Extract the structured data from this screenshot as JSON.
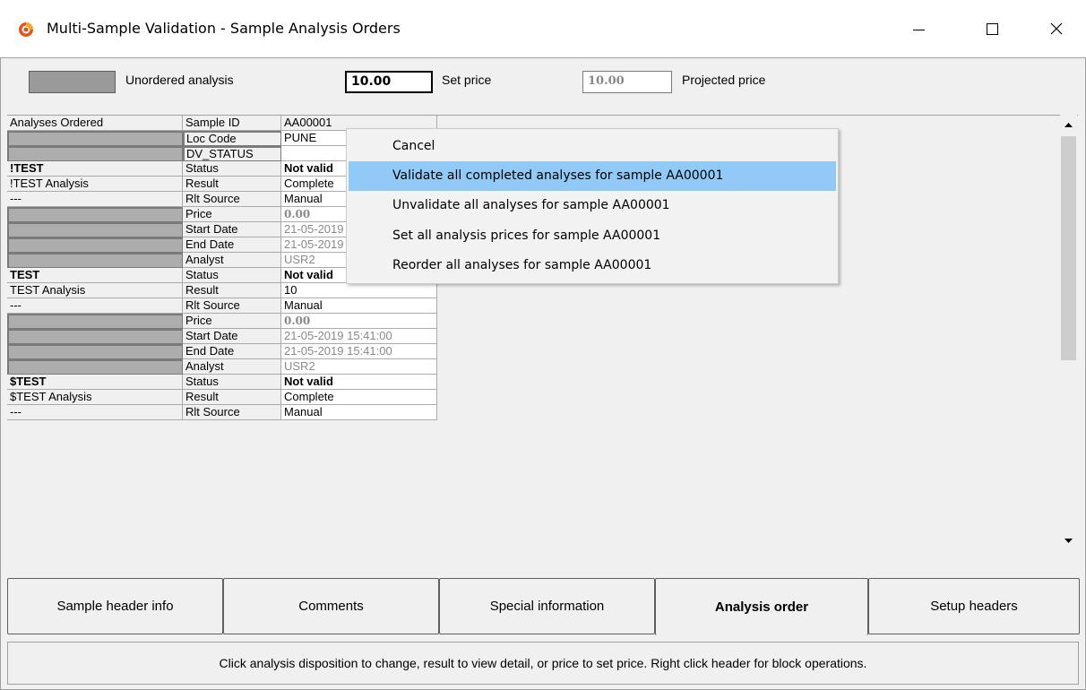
{
  "window": {
    "title": "Multi-Sample Validation - Sample Analysis Orders",
    "icon": "app-logo-icon",
    "buttons": [
      "minimize-icon",
      "maximize-icon",
      "close-icon"
    ]
  },
  "header": {
    "unordered_label": "Unordered analysis",
    "set_price_value": "10.00",
    "set_price_label": "Set price",
    "projected_price_value": "10.00",
    "projected_label": "Projected price",
    "unordered_color": "#9a9a9a"
  },
  "grid": {
    "rows": [
      {
        "a": "Analyses Ordered",
        "b": "Sample ID",
        "c": "AA00001"
      },
      {
        "a": "",
        "b": "Loc Code",
        "c": "PUNE"
      },
      {
        "a": "",
        "b": "DV_STATUS",
        "c": ""
      },
      {
        "a": "!TEST",
        "b": "Status",
        "c": "Not valid"
      },
      {
        "a": "!TEST Analysis",
        "b": "Result",
        "c": "Complete"
      },
      {
        "a": "---",
        "b": "Rlt Source",
        "c": "Manual"
      },
      {
        "a": "",
        "b": "Price",
        "c": "0.00"
      },
      {
        "a": "",
        "b": "Start Date",
        "c": "21-05-2019 15:41:00"
      },
      {
        "a": "",
        "b": "End Date",
        "c": "21-05-2019 15:41:00"
      },
      {
        "a": "",
        "b": "Analyst",
        "c": "USR2"
      },
      {
        "a": "TEST",
        "b": "Status",
        "c": "Not valid"
      },
      {
        "a": "TEST Analysis",
        "b": "Result",
        "c": "10"
      },
      {
        "a": "---",
        "b": "Rlt Source",
        "c": "Manual"
      },
      {
        "a": "",
        "b": "Price",
        "c": "0.00"
      },
      {
        "a": "",
        "b": "Start Date",
        "c": "21-05-2019 15:41:00"
      },
      {
        "a": "",
        "b": "End Date",
        "c": "21-05-2019 15:41:00"
      },
      {
        "a": "",
        "b": "Analyst",
        "c": "USR2"
      },
      {
        "a": "$TEST",
        "b": "Status",
        "c": "Not valid"
      },
      {
        "a": "$TEST Analysis",
        "b": "Result",
        "c": "Complete"
      },
      {
        "a": "---",
        "b": "Rlt Source",
        "c": "Manual"
      }
    ]
  },
  "context_menu": {
    "items": [
      "Cancel",
      "Validate all completed analyses for sample  AA00001",
      "Unvalidate all analyses for sample  AA00001",
      "Set all analysis prices for sample  AA00001",
      "Reorder all analyses for sample  AA00001"
    ],
    "highlighted_index": 1
  },
  "tabs": {
    "items": [
      "Sample header info",
      "Comments",
      "Special information",
      "Analysis order",
      "Setup headers"
    ],
    "active_index": 3
  },
  "status_bar": {
    "text": "Click analysis disposition to change, result to view detail, or price to set price.  Right click header for block operations."
  }
}
